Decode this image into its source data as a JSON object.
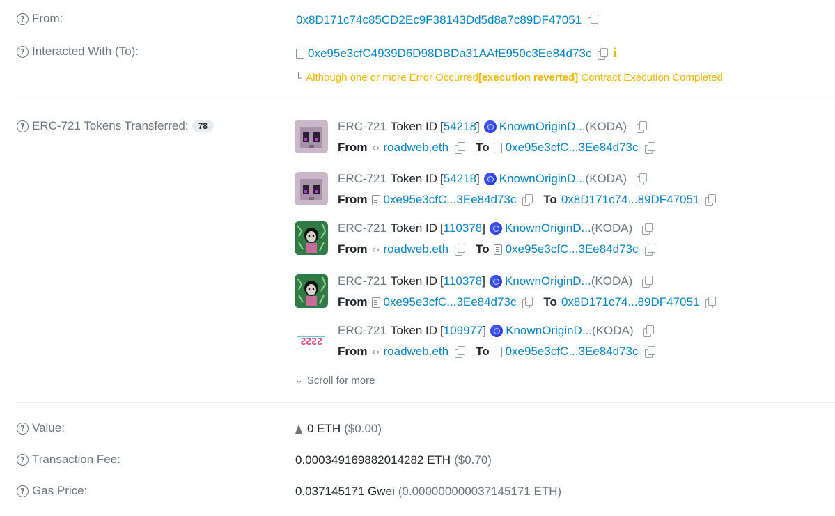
{
  "from": {
    "label": "From:",
    "address": "0x8D171c74c85CD2Ec9F38143Dd5d8a7c89DF47051"
  },
  "interacted": {
    "label": "Interacted With (To):",
    "address": "0xe95e3cfC4939D6D98DBDa31AAfE950c3Ee84d73c",
    "info_icon": "i",
    "warning_prefix": "Although one or more Error Occurred ",
    "warning_bold": "[execution reverted]",
    "warning_suffix": " Contract Execution Completed"
  },
  "tokens": {
    "label": "ERC-721 Tokens Transferred:",
    "count": "78",
    "standard": "ERC-721",
    "token_id_label": "Token ID",
    "from_label": "From",
    "to_label": "To",
    "items": [
      {
        "token_id": "54218",
        "collection": "KnownOriginD...",
        "symbol": "(KODA)",
        "from": "roadweb.eth",
        "from_kind": "ens",
        "to": "0xe95e3cfC...3Ee84d73c",
        "to_kind": "contract",
        "art": "pixel-creature"
      },
      {
        "token_id": "54218",
        "collection": "KnownOriginD...",
        "symbol": "(KODA)",
        "from": "0xe95e3cfC...3Ee84d73c",
        "from_kind": "contract",
        "to": "0x8D171c74...89DF47051",
        "to_kind": "address",
        "art": "pixel-creature"
      },
      {
        "token_id": "110378",
        "collection": "KnownOriginD...",
        "symbol": "(KODA)",
        "from": "roadweb.eth",
        "from_kind": "ens",
        "to": "0xe95e3cfC...3Ee84d73c",
        "to_kind": "contract",
        "art": "green-figure"
      },
      {
        "token_id": "110378",
        "collection": "KnownOriginD...",
        "symbol": "(KODA)",
        "from": "0xe95e3cfC...3Ee84d73c",
        "from_kind": "contract",
        "to": "0x8D171c74...89DF47051",
        "to_kind": "address",
        "art": "green-figure"
      },
      {
        "token_id": "109977",
        "collection": "KnownOriginD...",
        "symbol": "(KODA)",
        "from": "roadweb.eth",
        "from_kind": "ens",
        "to": "0xe95e3cfC...3Ee84d73c",
        "to_kind": "contract",
        "art": "pixel-text"
      }
    ],
    "scroll_more": "Scroll for more"
  },
  "value": {
    "label": "Value:",
    "amount": "0 ETH",
    "usd": "($0.00)"
  },
  "fee": {
    "label": "Transaction Fee:",
    "amount": "0.000349169882014282 ETH",
    "usd": "($0.70)"
  },
  "gas": {
    "label": "Gas Price:",
    "amount": "0.037145171 Gwei",
    "eth": "(0.000000000037145171 ETH)"
  }
}
